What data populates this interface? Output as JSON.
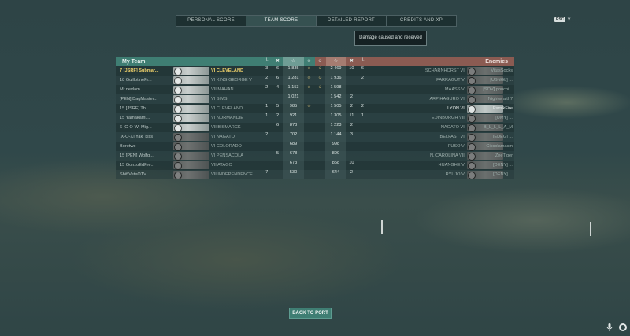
{
  "tabs": [
    "PERSONAL SCORE",
    "TEAM SCORE",
    "DETAILED REPORT",
    "CREDITS AND XP"
  ],
  "tooltip": "Damage caused and received",
  "esc_label": "ESC",
  "close_glyph": "×",
  "my_team_label": "My Team",
  "enemies_label": "Enemies",
  "header_icons": {
    "left": [
      "╰",
      "✖",
      "☆",
      "☺"
    ],
    "right": [
      "☺",
      "☆",
      "✖",
      "╰"
    ]
  },
  "rows": [
    {
      "left_player": "7 [JSRF] Submar...",
      "left_me": true,
      "left_ship": "VI  CLEVELAND",
      "c1": "3",
      "c2": "6",
      "xp": "1 835",
      "e1": "☺",
      "e2": "☺",
      "exp": "2 469",
      "k": "10",
      "f": "6",
      "right_ship": "SCHARNHORST  VII",
      "right_player": "VitasSocks"
    },
    {
      "left_player": "18 GuillotineFr...",
      "left_ship": "VI  KING GEORGE V",
      "c1": "2",
      "c2": "6",
      "xp": "1 281",
      "e1": "☺",
      "e2": "☺",
      "exp": "1 936",
      "k": "",
      "f": "2",
      "right_ship": "FARRAGUT  VI",
      "right_player": "[USNGL]  ..."
    },
    {
      "left_player": "Mr.nevlam",
      "left_ship": "VII  MAHAN",
      "c1": "2",
      "c2": "4",
      "xp": "1 153",
      "e1": "☺",
      "e2": "☺",
      "exp": "1 598",
      "k": "",
      "f": "",
      "right_ship": "MAASS  VI",
      "right_player": "[SOV]  ponchi..."
    },
    {
      "left_player": "[PEN] DagMaster...",
      "left_ship": "VI  SIMS",
      "c1": "",
      "c2": "",
      "xp": "1 021",
      "e1": "",
      "e2": "",
      "exp": "1 542",
      "k": "2",
      "f": "",
      "right_ship": "ARP HAGURO  VII",
      "right_player": "Nightwraith7"
    },
    {
      "left_player": "15 [JSRF] Th...",
      "left_ship": "VI  CLEVELAND",
      "c1": "1",
      "c2": "5",
      "xp": "985",
      "e1": "☺",
      "e2": "",
      "exp": "1 505",
      "k": "2",
      "f": "2",
      "right_ship": "LYON  VII",
      "right_player": "PamikFire",
      "right_alive": true
    },
    {
      "left_player": "15 Yamakami...",
      "left_ship": "VI  NORMANDIE",
      "c1": "1",
      "c2": "2",
      "xp": "921",
      "e1": "",
      "e2": "",
      "exp": "1 305",
      "k": "11",
      "f": "1",
      "right_ship": "EDINBURGH  VIII",
      "right_player": "[UMY]  ..."
    },
    {
      "left_player": "6 [G-O-W] Mig...",
      "left_ship": "VII  BISMARCK",
      "c1": "",
      "c2": "6",
      "xp": "873",
      "e1": "",
      "e2": "",
      "exp": "1 223",
      "k": "2",
      "f": "",
      "right_ship": "NAGATO  VII",
      "right_player": "B_L_L_L_A_M"
    },
    {
      "left_player": "[X-O-X] Yak_kiss",
      "left_ship": "VI  NAGATO",
      "c1": "2",
      "c2": "",
      "xp": "702",
      "e1": "",
      "e2": "",
      "exp": "1 144",
      "k": "3",
      "f": "",
      "right_ship": "BELFAST  VII",
      "right_player": "[EDEG]  ..."
    },
    {
      "left_player": "Boretwo",
      "left_ship": "VI  COLORADO",
      "c1": "",
      "c2": "",
      "xp": "689",
      "e1": "",
      "e2": "",
      "exp": "998",
      "k": "",
      "f": "",
      "right_ship": "FUSO  VI",
      "right_player": "Ciccolamasm"
    },
    {
      "left_player": "15 [PEN] Wolfg...",
      "left_ship": "VI  PENSACOLA",
      "c1": "",
      "c2": "5",
      "xp": "678",
      "e1": "",
      "e2": "",
      "exp": "899",
      "k": "",
      "f": "",
      "right_ship": "N. CAROLINA  VIII",
      "right_player": "ZeeTiger"
    },
    {
      "left_player": "15 GonzoEdFre...",
      "left_ship": "VII  ATAGO",
      "c1": "",
      "c2": "",
      "xp": "673",
      "e1": "",
      "e2": "",
      "exp": "858",
      "k": "10",
      "f": "",
      "right_ship": "HUANGHE  VI",
      "right_player": "[DENY]  ..."
    },
    {
      "left_player": "ShiftVeteOTV",
      "left_ship": "VII  INDEPENDENCE",
      "c1": "7",
      "c2": "",
      "xp": "530",
      "e1": "",
      "e2": "",
      "exp": "644",
      "k": "2",
      "f": "",
      "right_ship": "RYUJO  VI",
      "right_player": "[DENY]  ..."
    }
  ],
  "back_button": "BACK TO PORT"
}
